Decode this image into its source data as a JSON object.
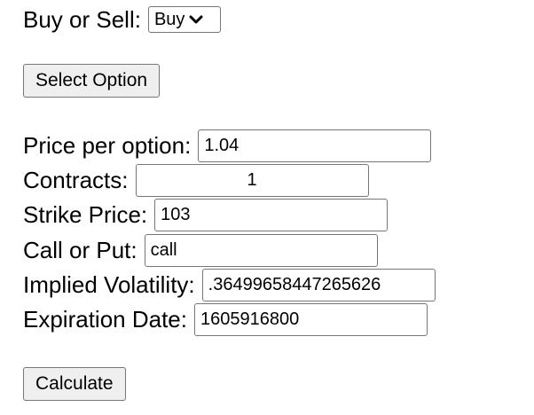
{
  "buy_sell": {
    "label": "Buy or Sell:",
    "selected": "Buy",
    "options": [
      "Buy"
    ]
  },
  "select_option_button": "Select Option",
  "fields": {
    "price_per_option": {
      "label": "Price per option:",
      "value": "1.04"
    },
    "contracts": {
      "label": "Contracts:",
      "value": "1"
    },
    "strike_price": {
      "label": "Strike Price:",
      "value": "103"
    },
    "call_or_put": {
      "label": "Call or Put:",
      "value": "call"
    },
    "implied_volatility": {
      "label": "Implied Volatility:",
      "value": ".36499658447265626"
    },
    "expiration_date": {
      "label": "Expiration Date:",
      "value": "1605916800"
    }
  },
  "calculate_button": "Calculate",
  "icons": {
    "select_chevron": "chevron-down-icon"
  }
}
